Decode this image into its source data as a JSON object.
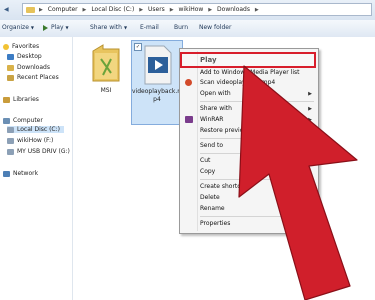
{
  "address_bar": {
    "crumbs": [
      "Computer",
      "Local Disc (C:)",
      "Users",
      "wikiHow",
      "Downloads"
    ]
  },
  "toolbar": {
    "organize": "Organize",
    "play": "Play",
    "share_with": "Share with",
    "email": "E-mail",
    "burn": "Burn",
    "new_folder": "New folder"
  },
  "nav": {
    "favorites": "Favorites",
    "desktop": "Desktop",
    "downloads": "Downloads",
    "recent_places": "Recent Places",
    "libraries": "Libraries",
    "computer": "Computer",
    "local_disc": "Local Disc (C:)",
    "wikihow_drive": "wikiHow (F:)",
    "usb_drive": "MY USB DRIV (G:)",
    "network": "Network"
  },
  "files": {
    "msi": "MSI",
    "video_line1": "videoplayback.m",
    "video_line2": "p4"
  },
  "context_menu": {
    "play": "Play",
    "add_to_wmp": "Add to Windows Media Player list",
    "scan": "Scan videoplayback.mp4",
    "open_with": "Open with",
    "share_with": "Share with",
    "winrar": "WinRAR",
    "restore": "Restore previous versions",
    "send_to": "Send to",
    "cut": "Cut",
    "copy": "Copy",
    "create_shortcut": "Create shortcut",
    "delete": "Delete",
    "rename": "Rename",
    "properties": "Properties"
  },
  "colors": {
    "highlight_red": "#d81e2c",
    "arrow_red": "#d01f2b"
  }
}
